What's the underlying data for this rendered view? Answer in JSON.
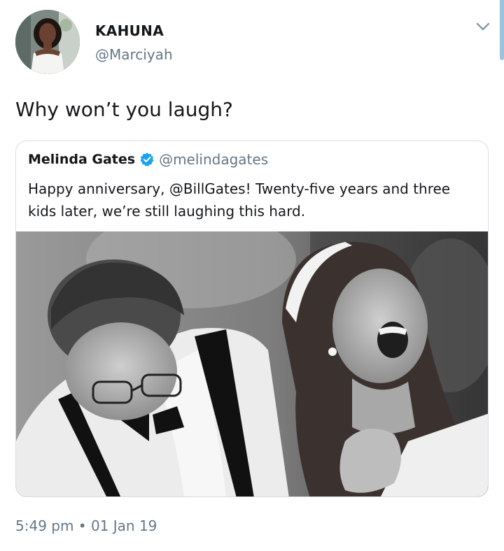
{
  "profile": {
    "display_name": "KAHUNA",
    "handle": "@Marciyah"
  },
  "tweet": {
    "text": "Why won’t you laugh?",
    "timestamp": "5:49 pm • 01 Jan 19"
  },
  "quoted_tweet": {
    "author_name": "Melinda Gates",
    "verified": true,
    "author_handle": "@melindagates",
    "text": "Happy anniversary, @BillGates! Twenty-five years and three kids later, we’re still laughing this hard."
  },
  "icons": {
    "menu": "chevron-down-icon",
    "verified": "verified-badge-icon"
  },
  "colors": {
    "accent": "#1da1f2",
    "secondary_text": "#657786",
    "border": "#d7dde2",
    "scrollbar": "#9dc2dc"
  }
}
